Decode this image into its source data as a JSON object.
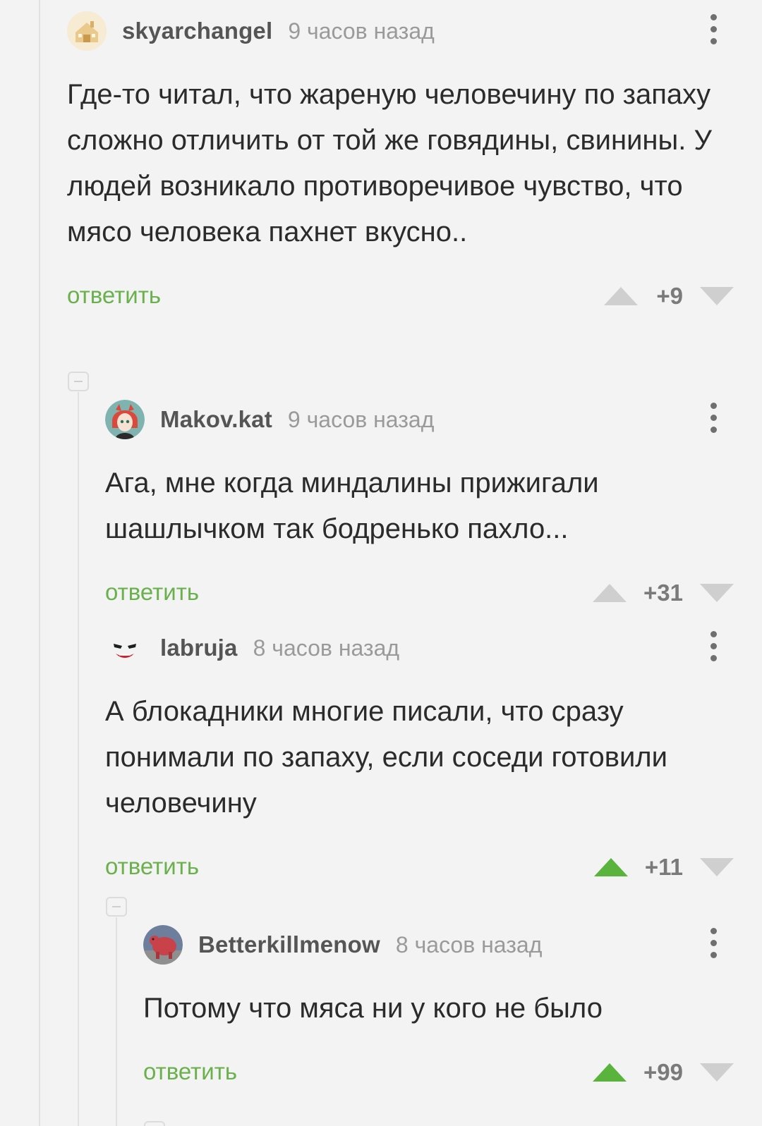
{
  "colors": {
    "background": "#f3f3f3",
    "reply_link": "#6ab04c",
    "vote_active": "#59b33c",
    "vote_inactive": "#cfcfcf"
  },
  "comments": [
    {
      "username": "skyarchangel",
      "time": "9 часов назад",
      "text": "Где-то читал, что жареную человечину по запаху сложно отличить от той же говядины, свинины. У людей возникало противоречивое чувство, что мясо человека пахнет вкусно..",
      "reply_label": "ответить",
      "score": "+9",
      "upvoted": false,
      "avatar_icon": "house-avatar-icon"
    },
    {
      "username": "Makov.kat",
      "time": "9 часов назад",
      "text": "Ага, мне когда миндалины прижигали шашлычком так бодренько пахло...",
      "reply_label": "ответить",
      "score": "+31",
      "upvoted": false,
      "avatar_icon": "anime-girl-avatar-icon"
    },
    {
      "username": "labruja",
      "time": "8 часов назад",
      "text": "А блокадники многие писали, что сразу понимали по запаху, если соседи готовили человечину",
      "reply_label": "ответить",
      "score": "+11",
      "upvoted": true,
      "avatar_icon": "joker-face-avatar-icon"
    },
    {
      "username": "Betterkillmenow",
      "time": "8 часов назад",
      "text": "Потому что мяса ни у кого не было",
      "reply_label": "ответить",
      "score": "+99",
      "upvoted": true,
      "avatar_icon": "red-creature-avatar-icon"
    }
  ]
}
